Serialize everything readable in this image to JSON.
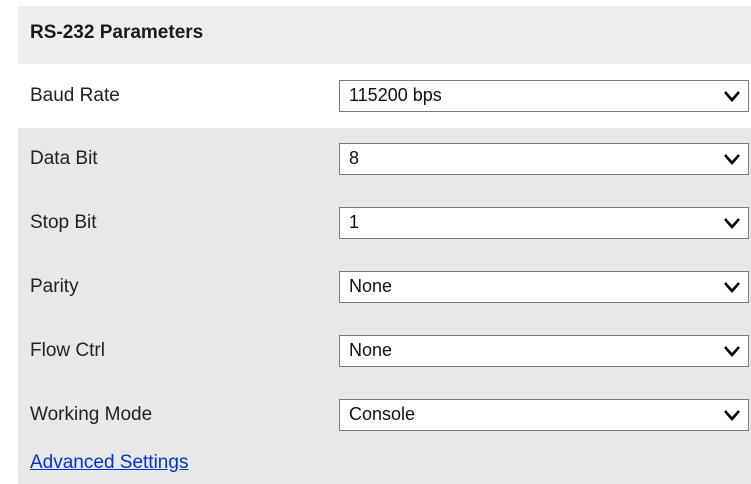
{
  "panel": {
    "title": "RS-232 Parameters"
  },
  "fields": [
    {
      "label": "Baud Rate",
      "value": "115200 bps"
    },
    {
      "label": "Data Bit",
      "value": "8"
    },
    {
      "label": "Stop Bit",
      "value": "1"
    },
    {
      "label": "Parity",
      "value": "None"
    },
    {
      "label": "Flow Ctrl",
      "value": "None"
    },
    {
      "label": "Working Mode",
      "value": "Console"
    }
  ],
  "advanced_link": "Advanced Settings",
  "colors": {
    "link": "#0033cc",
    "panel_bg": "#e8e8e8",
    "highlight_row_bg": "#ffffff"
  },
  "icons": {
    "dropdown": "chevron-down-icon"
  }
}
